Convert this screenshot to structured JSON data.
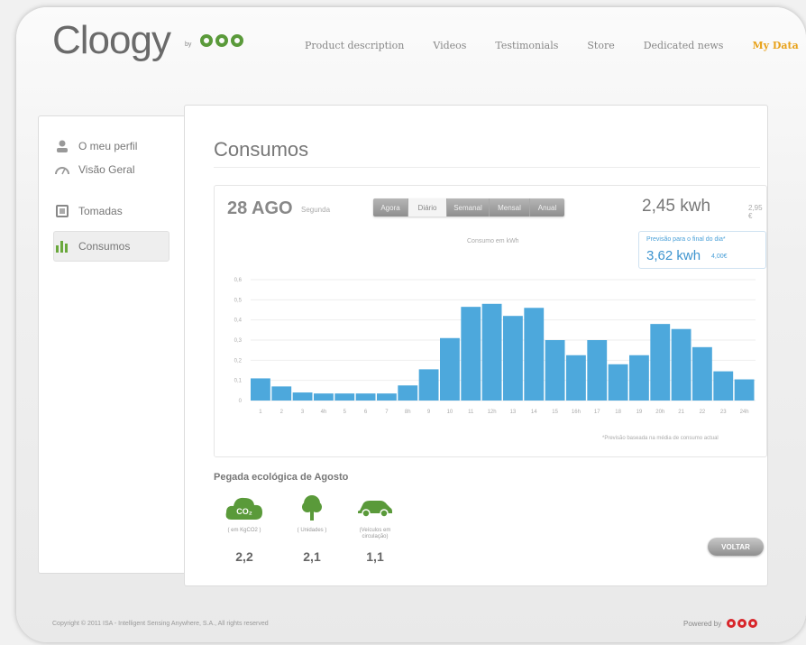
{
  "header": {
    "logo_text": "Cloogy",
    "logo_by": "by",
    "nav": [
      "Product description",
      "Videos",
      "Testimonials",
      "Store",
      "Dedicated news",
      "My Data"
    ],
    "active_nav": "My Data"
  },
  "sidebar": {
    "items": [
      {
        "label": "O meu perfil",
        "icon": "user-icon"
      },
      {
        "label": "Visão Geral",
        "icon": "gauge-icon"
      },
      {
        "label": "Tomadas",
        "icon": "plug-icon"
      },
      {
        "label": "Consumos",
        "icon": "bar-chart-icon",
        "active": true
      }
    ]
  },
  "main": {
    "title": "Consumos",
    "date": "28 AGO",
    "weekday": "Segunda",
    "tabs": [
      "Agora",
      "Diário",
      "Semanal",
      "Mensal",
      "Anual"
    ],
    "selected_tab": "Diário",
    "total": "2,45 kwh",
    "total_cost": "2,95 €",
    "forecast_label": "Previsão para o final do dia*",
    "forecast_value": "3,62 kwh",
    "forecast_cost": "4,00€",
    "chart_title": "Consumo em kWh",
    "note": "*Previsão baseada na média de consumo actual"
  },
  "chart_data": {
    "type": "bar",
    "title": "Consumo em kWh",
    "categories": [
      "1",
      "2",
      "3",
      "4h",
      "5",
      "6",
      "7",
      "8h",
      "9",
      "10",
      "11",
      "12h",
      "13",
      "14",
      "15",
      "16h",
      "17",
      "18",
      "19",
      "20h",
      "21",
      "22",
      "23",
      "24h"
    ],
    "values": [
      0.11,
      0.07,
      0.04,
      0.035,
      0.035,
      0.035,
      0.035,
      0.075,
      0.155,
      0.31,
      0.465,
      0.48,
      0.42,
      0.46,
      0.3,
      0.225,
      0.3,
      0.18,
      0.225,
      0.38,
      0.355,
      0.265,
      0.145,
      0.105
    ],
    "ylim": [
      0,
      0.6
    ],
    "yticks": [
      "0",
      "0,1",
      "0,2",
      "0,3",
      "0,4",
      "0,5",
      "0,6"
    ],
    "color": "#4da8dc",
    "grid": true
  },
  "eco": {
    "title": "Pegada ecológica de Agosto",
    "items": [
      {
        "icon": "co2-cloud-icon",
        "unit": "( em KgCO2 )",
        "value": "2,2"
      },
      {
        "icon": "tree-icon",
        "unit": "( Unidades )",
        "value": "2,1"
      },
      {
        "icon": "car-icon",
        "unit": "(Veículos em circulação)",
        "value": "1,1"
      }
    ],
    "icon_color": "#5a9a3a"
  },
  "button": {
    "back": "VOLTAR"
  },
  "footer": {
    "copyright": "Copyright © 2011 ISA - Intelligent Sensing Anywhere, S.A., All rights reserved",
    "powered": "Powered by"
  }
}
